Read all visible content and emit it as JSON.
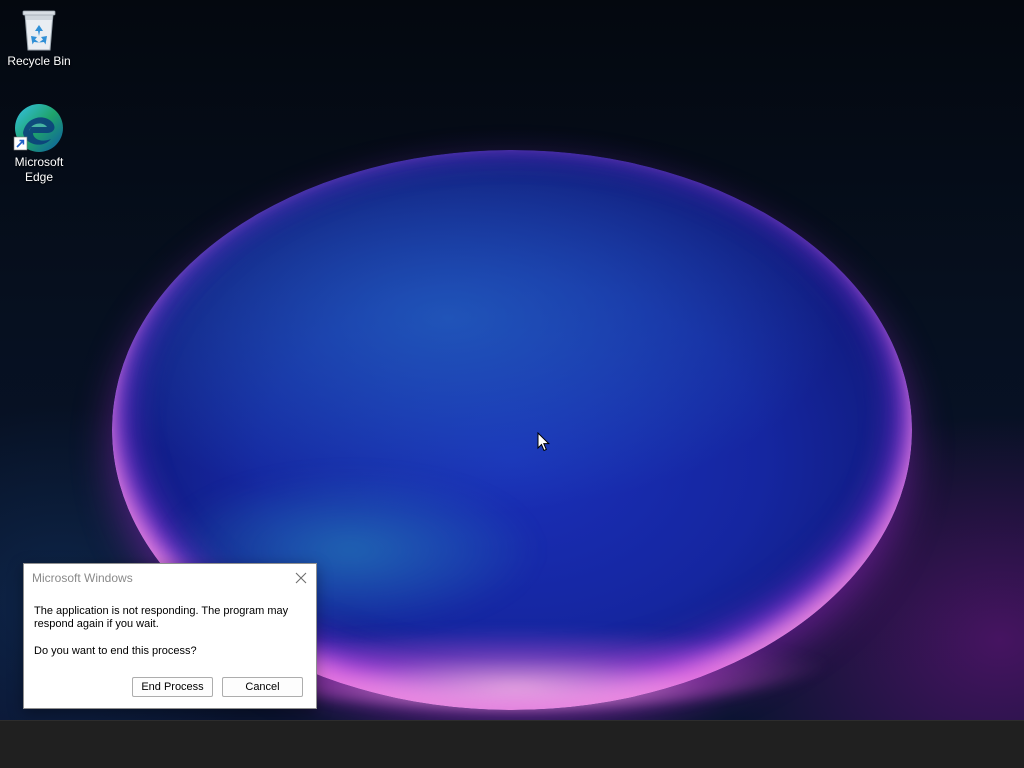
{
  "desktop": {
    "icons": [
      {
        "label": "Recycle Bin",
        "icon": "recycle-bin-icon"
      },
      {
        "label": "Microsoft Edge",
        "icon": "edge-icon"
      }
    ]
  },
  "dialog": {
    "title": "Microsoft Windows",
    "message": "The application is not responding. The program may respond again if you wait.",
    "question": "Do you want to end this process?",
    "buttons": {
      "end_process": "End Process",
      "cancel": "Cancel"
    },
    "close_icon": "close-icon"
  },
  "colors": {
    "taskbar": "#202020",
    "dialog_bg": "#ffffff",
    "title_text": "#8a8a8a"
  }
}
